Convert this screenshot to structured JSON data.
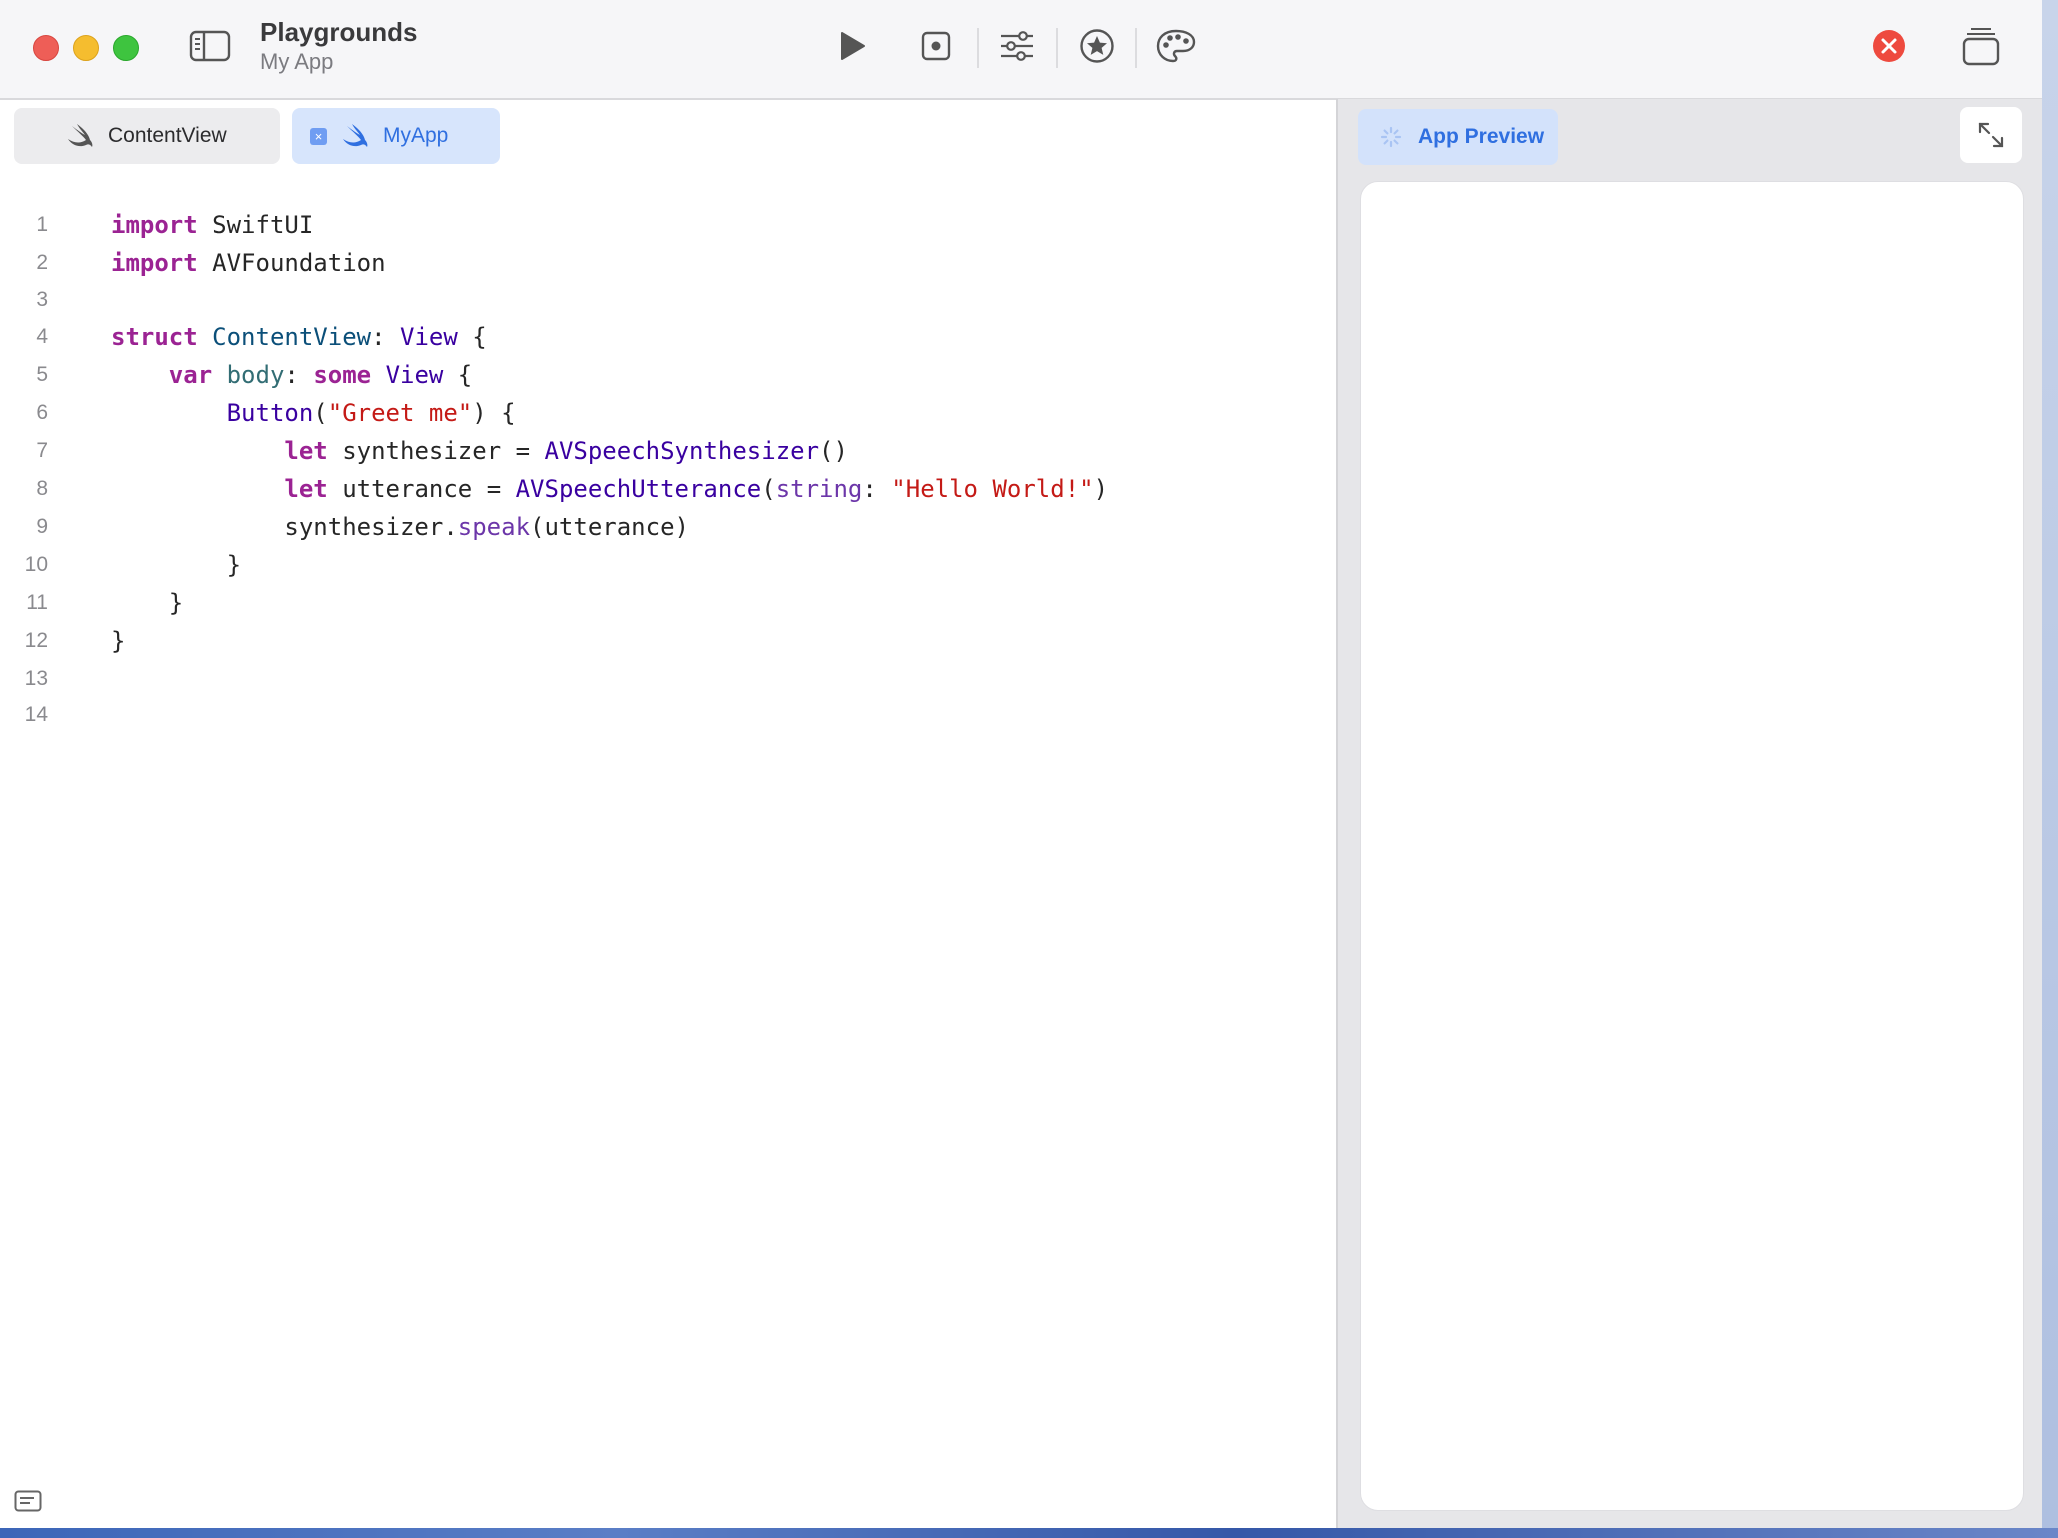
{
  "app": {
    "title": "Playgrounds",
    "subtitle": "My App"
  },
  "toolbar": {
    "buttons": [
      "play-icon",
      "stop-icon",
      "sliders-icon",
      "star-icon",
      "palette-icon"
    ],
    "error_color": "#ee4a3f"
  },
  "tabs": [
    {
      "label": "ContentView",
      "icon": "swift-icon",
      "active": false
    },
    {
      "label": "MyApp",
      "icon": "swift-icon",
      "active": true,
      "close": "×"
    }
  ],
  "editor": {
    "line_numbers": [
      "1",
      "2",
      "3",
      "4",
      "5",
      "6",
      "7",
      "8",
      "9",
      "10",
      "11",
      "12",
      "13",
      "14"
    ],
    "lines": [
      [
        {
          "t": "import",
          "c": "kw"
        },
        {
          "t": " SwiftUI",
          "c": ""
        }
      ],
      [
        {
          "t": "import",
          "c": "kw"
        },
        {
          "t": " AVFoundation",
          "c": ""
        }
      ],
      [],
      [
        {
          "t": "struct",
          "c": "kw"
        },
        {
          "t": " ",
          "c": ""
        },
        {
          "t": "ContentView",
          "c": "tyd"
        },
        {
          "t": ": ",
          "c": ""
        },
        {
          "t": "View",
          "c": "ty"
        },
        {
          "t": " {",
          "c": ""
        }
      ],
      [
        {
          "t": "    ",
          "c": ""
        },
        {
          "t": "var",
          "c": "kw"
        },
        {
          "t": " ",
          "c": ""
        },
        {
          "t": "body",
          "c": "idn"
        },
        {
          "t": ": ",
          "c": ""
        },
        {
          "t": "some",
          "c": "kw"
        },
        {
          "t": " ",
          "c": ""
        },
        {
          "t": "View",
          "c": "ty"
        },
        {
          "t": " {",
          "c": ""
        }
      ],
      [
        {
          "t": "        ",
          "c": ""
        },
        {
          "t": "Button",
          "c": "ty"
        },
        {
          "t": "(",
          "c": ""
        },
        {
          "t": "\"Greet me\"",
          "c": "str"
        },
        {
          "t": ") {",
          "c": ""
        }
      ],
      [
        {
          "t": "            ",
          "c": ""
        },
        {
          "t": "let",
          "c": "kw"
        },
        {
          "t": " synthesizer = ",
          "c": ""
        },
        {
          "t": "AVSpeechSynthesizer",
          "c": "ty"
        },
        {
          "t": "()",
          "c": ""
        }
      ],
      [
        {
          "t": "            ",
          "c": ""
        },
        {
          "t": "let",
          "c": "kw"
        },
        {
          "t": " utterance = ",
          "c": ""
        },
        {
          "t": "AVSpeechUtterance",
          "c": "ty"
        },
        {
          "t": "(",
          "c": ""
        },
        {
          "t": "string",
          "c": "par"
        },
        {
          "t": ": ",
          "c": ""
        },
        {
          "t": "\"Hello World!\"",
          "c": "str"
        },
        {
          "t": ")",
          "c": ""
        }
      ],
      [
        {
          "t": "            synthesizer.",
          "c": ""
        },
        {
          "t": "speak",
          "c": "fn"
        },
        {
          "t": "(utterance)",
          "c": ""
        }
      ],
      [
        {
          "t": "        }",
          "c": ""
        }
      ],
      [
        {
          "t": "    }",
          "c": ""
        }
      ],
      [
        {
          "t": "}",
          "c": ""
        }
      ],
      [],
      []
    ]
  },
  "preview": {
    "tab_label": "App Preview"
  }
}
